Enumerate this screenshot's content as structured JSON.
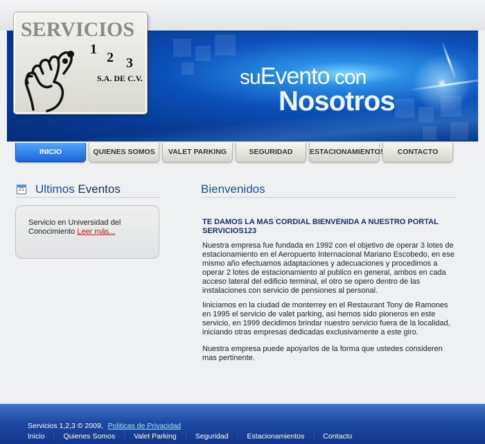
{
  "logo": {
    "title": "SERVICIOS",
    "numbers": [
      "1",
      "2",
      "3"
    ],
    "subtitle": "S.A. DE C.V."
  },
  "banner": {
    "slogan_small": "su",
    "slogan_evento": "Evento",
    "slogan_con": "con",
    "slogan_big": "Nosotros"
  },
  "nav": {
    "items": [
      {
        "label": "INICIO",
        "active": true
      },
      {
        "label": "QUIENES SOMOS"
      },
      {
        "label": "VALET PARKING"
      },
      {
        "label": "SEGURIDAD"
      },
      {
        "label": "ESTACIONAMIENTOS"
      },
      {
        "label": "CONTACTO"
      }
    ]
  },
  "eventos": {
    "calendar_day": "21",
    "title_part1": "Ultimos",
    "title_part2": "Eventos",
    "item_text": "Servicio en Universidad del Conocimiento",
    "item_link": "Leer más..."
  },
  "bienvenidos": {
    "title": "Bienvenidos",
    "welcome": "TE DAMOS LA MAS CORDIAL BIENVENIDA A NUESTRO PORTAL SERVICIOS123",
    "paragraphs": [
      "Nuestra empresa fue fundada en 1992 con el objetivo de operar 3 lotes de estacionamiento en el Aeropuerto Internacional Mariano Escobedo, en ese mismo año efectuamos adaptaciones y adecuaciones y procedimos a operar 2 lotes de estacionamiento al publico en general, ambos en cada acceso lateral del edificio terminal, el otro se opero dentro de las instalaciones con servicio de pensiones al personal.",
      "Iiniciamos en la ciudad de monterrey en el Restaurant Tony de Ramones en 1995 el servicio de valet parking, asi hemos sido pioneros en este servicio, en 1999 decidimos brindar nuestro servicio fuera de la localidad, iniciando otras empresas dedicadas exclusivamente a este giro.",
      "Nuestra empresa puede apoyarlos de la forma que ustedes consideren mas pertinente."
    ]
  },
  "footer": {
    "copyright": "Servicios 1,2,3 © 2009,",
    "privacy_link": "Politicas de Privacidad",
    "nav": [
      "Inicio",
      "Quienes Somos",
      "Valet Parking",
      "Seguridad",
      "Estacionamientos",
      "Contacto"
    ],
    "separator": ":"
  },
  "colors": {
    "accent": "#1c4f9e",
    "nav_active": "#1a63d6",
    "link_red": "#c11818",
    "footer_blue": "#1d4aa0"
  }
}
